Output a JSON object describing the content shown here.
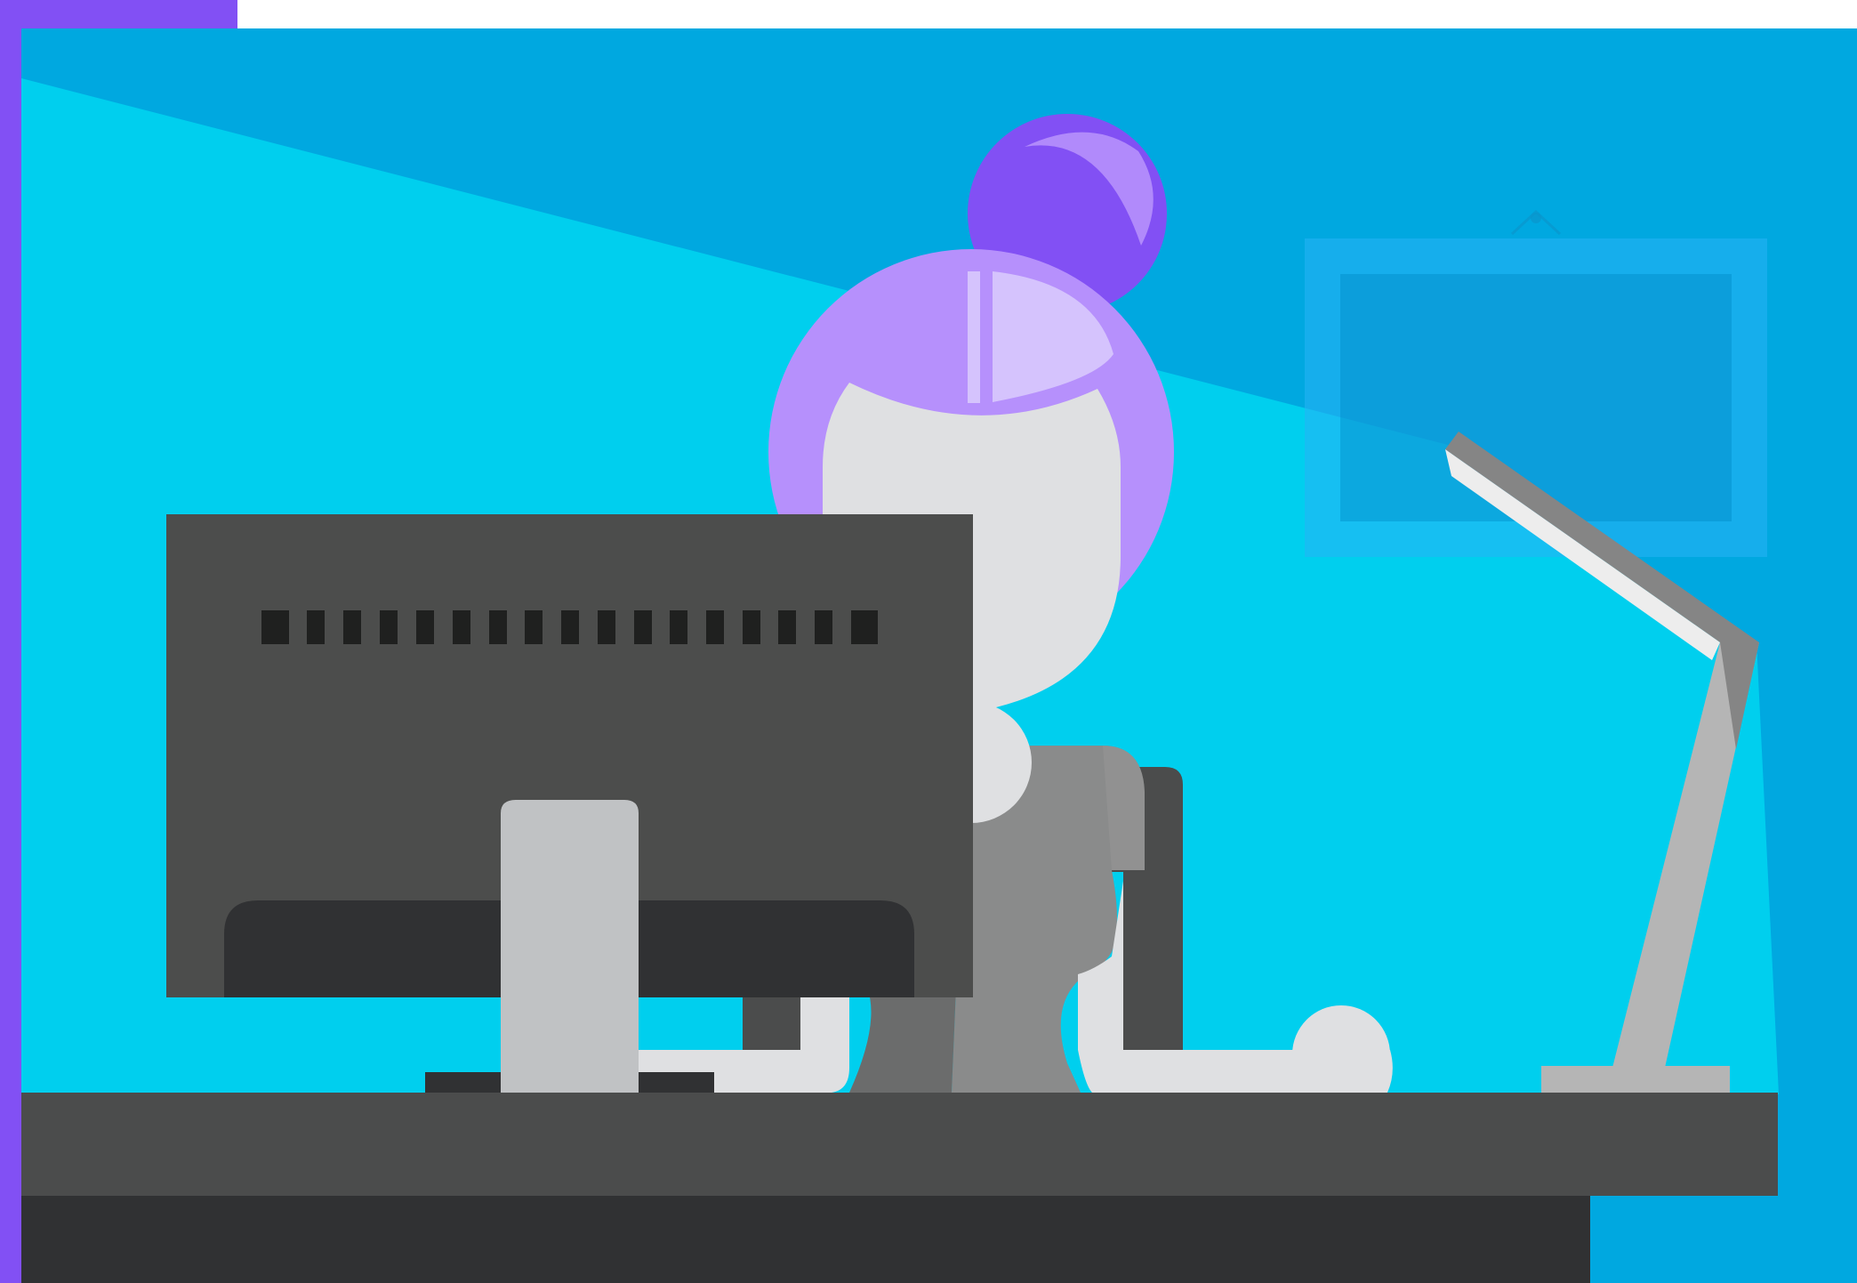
{
  "scene": {
    "subject": "person-at-computer-desk",
    "elements": [
      "purple-corner-frame",
      "wall",
      "lamp-light-beam",
      "picture-frame",
      "desk-lamp",
      "person",
      "office-chair",
      "monitor",
      "keyboard",
      "desk"
    ],
    "colors": {
      "frame": "#8250f4",
      "wall": "#00a8e0",
      "light": "#00cfee",
      "hair": "#8250f4",
      "hair_light": "#b690fc",
      "skin": "#dfe0e2",
      "shirt": "#8a8b8b",
      "pants": "#6b6c6c",
      "chair": "#4b4c4c",
      "monitor": "#4c4d4c",
      "monitor_vent": "#1f201f",
      "monitor_stand": "#c0c2c4",
      "desk": "#4b4c4c",
      "desk_shadow": "#303133",
      "lamp_dark": "#858585",
      "lamp_light": "#b5b5b5",
      "lamp_highlight": "#ededed",
      "picture_frame": "#0aa9e4"
    }
  }
}
